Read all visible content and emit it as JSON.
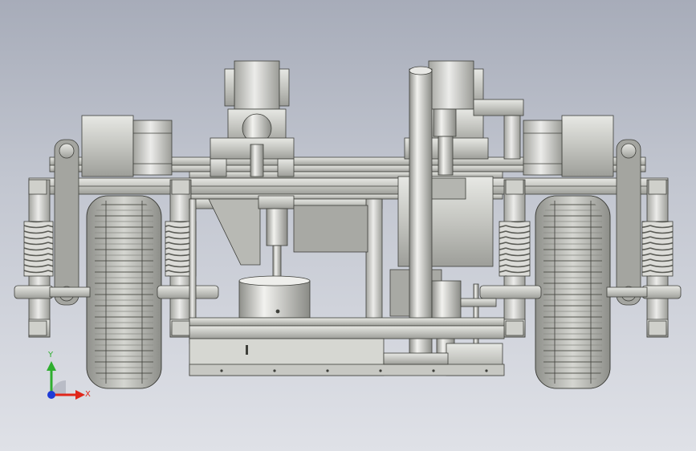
{
  "viewport": {
    "background_top": "#a7acb9",
    "background_bottom": "#dfe1e7",
    "model_color": "#c9cac5"
  },
  "triad": {
    "x_label": "X",
    "y_label": "Y",
    "x_color": "#e0261a",
    "y_color": "#2fae2f",
    "z_color": "#1e3bd6"
  }
}
